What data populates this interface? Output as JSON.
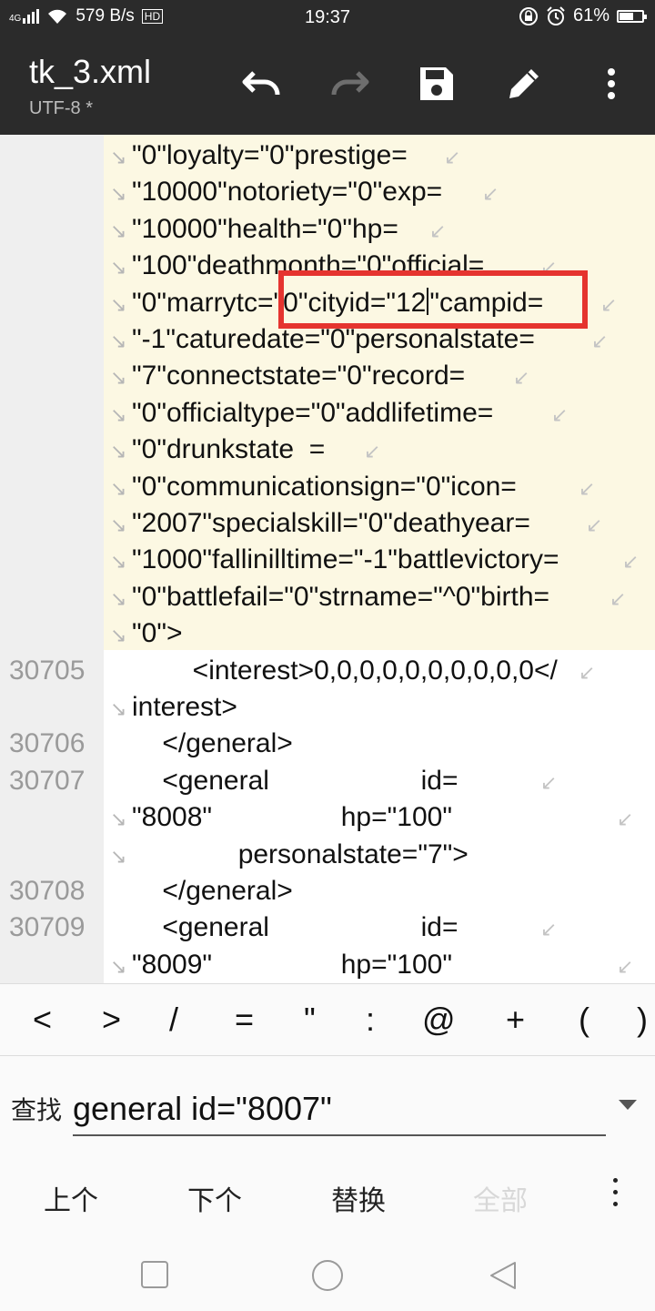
{
  "status_bar": {
    "network": "4G",
    "speed": "579 B/s",
    "hd": "HD",
    "time": "19:37",
    "battery": "61%",
    "battery_level": 0.61
  },
  "toolbar": {
    "title": "tk_3.xml",
    "encoding": "UTF-8 *",
    "icons": [
      "undo-icon",
      "redo-icon",
      "save-icon",
      "edit-icon",
      "more-icon"
    ]
  },
  "editor": {
    "lines": [
      {
        "num": "",
        "text": "\"0\"loyalty=\"0\"prestige="
      },
      {
        "num": "",
        "text": "\"10000\"notoriety=\"0\"exp="
      },
      {
        "num": "",
        "text": "\"10000\"health=\"0\"hp="
      },
      {
        "num": "",
        "text": "\"100\"deathmonth=\"0\"official="
      },
      {
        "num": "",
        "text_before_cursor": "\"0\"marrytc=\"0\"cityid=\"12",
        "text_after_cursor": "\"campid="
      },
      {
        "num": "",
        "text": "\"-1\"caturedate=\"0\"personalstate="
      },
      {
        "num": "",
        "text": "\"7\"connectstate=\"0\"record="
      },
      {
        "num": "",
        "text": "\"0\"officialtype=\"0\"addlifetime="
      },
      {
        "num": "",
        "text": "\"0\"drunkstate  ="
      },
      {
        "num": "",
        "text": "\"0\"communicationsign=\"0\"icon="
      },
      {
        "num": "",
        "text": "\"2007\"specialskill=\"0\"deathyear="
      },
      {
        "num": "",
        "text": "\"1000\"fallinilltime=\"-1\"battlevictory="
      },
      {
        "num": "",
        "text": "\"0\"battlefail=\"0\"strname=\"^0\"birth="
      },
      {
        "num": "",
        "text": "\"0\">"
      },
      {
        "num": "30705",
        "text": "        <interest>0,0,0,0,0,0,0,0,0,0</"
      },
      {
        "num": "",
        "text": "interest>"
      },
      {
        "num": "30706",
        "text": "    </general>"
      },
      {
        "num": "",
        "text": "    <general                    id="
      },
      {
        "num": "",
        "text": "\"8008\"                 hp=\"100\""
      },
      {
        "num": "",
        "text": "              personalstate=\"7\">"
      },
      {
        "num": "30708",
        "text": "    </general>"
      },
      {
        "num": "30709",
        "text": "    <general                    id="
      },
      {
        "num": "",
        "text": "\"8009\"                 hp=\"100\""
      }
    ],
    "line_numbers_extra": {
      "row17": "30707"
    }
  },
  "symbols": [
    "<",
    ">",
    "/",
    "=",
    "\"",
    ":",
    "@",
    "+",
    "(",
    ")"
  ],
  "search": {
    "label": "查找",
    "value": "general id=\"8007\""
  },
  "actions": {
    "prev": "上个",
    "next": "下个",
    "replace": "替换",
    "all": "全部"
  }
}
